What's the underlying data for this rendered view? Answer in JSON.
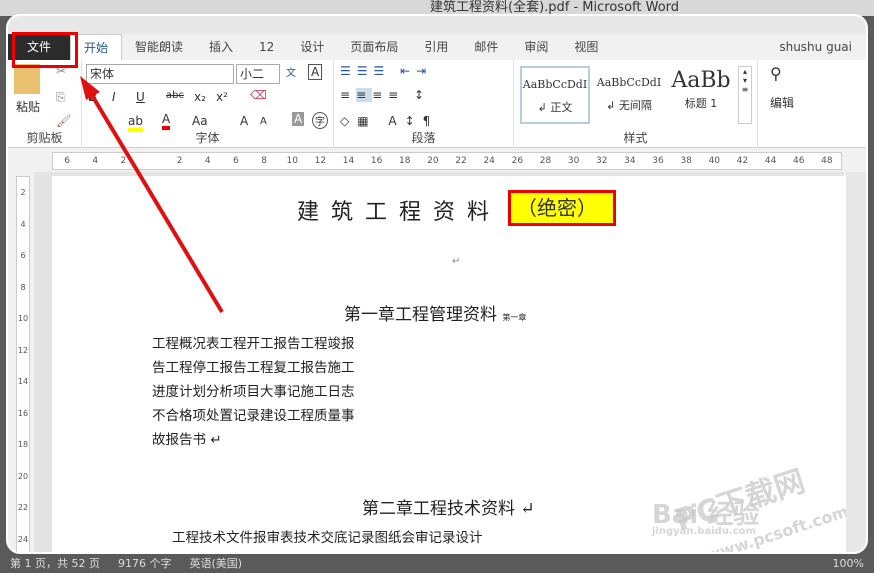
{
  "window": {
    "title": "建筑工程资料(全套).pdf - Microsoft Word",
    "user": "shushu guai"
  },
  "tabs": [
    {
      "label": "文件"
    },
    {
      "label": "开始"
    },
    {
      "label": "智能朗读"
    },
    {
      "label": "插入"
    },
    {
      "label": "12"
    },
    {
      "label": "设计"
    },
    {
      "label": "页面布局"
    },
    {
      "label": "引用"
    },
    {
      "label": "邮件"
    },
    {
      "label": "审阅"
    },
    {
      "label": "视图"
    }
  ],
  "ribbon": {
    "clipboard": {
      "label": "剪贴板",
      "paste": "粘贴"
    },
    "font": {
      "label": "字体",
      "name": "宋体",
      "size": "小二",
      "bold": "B",
      "italic": "I",
      "underline": "U",
      "strike": "abc",
      "sub": "x₂",
      "sup": "x²",
      "color": "A",
      "case": "Aa",
      "grow": "A",
      "shrink": "A",
      "wen": "文"
    },
    "paragraph": {
      "label": "段落"
    },
    "styles": {
      "label": "样式",
      "items": [
        {
          "preview": "AaBbCcDdI",
          "name": "↲ 正文"
        },
        {
          "preview": "AaBbCcDdI",
          "name": "↲ 无间隔"
        },
        {
          "preview": "AaBb",
          "name": "标题 1"
        }
      ]
    },
    "editing": {
      "label": "编辑"
    }
  },
  "ruler": {
    "h": [
      "6",
      "4",
      "2",
      "",
      "2",
      "4",
      "6",
      "8",
      "10",
      "12",
      "14",
      "16",
      "18",
      "20",
      "22",
      "24",
      "26",
      "28",
      "30",
      "32",
      "34",
      "36",
      "38",
      "40",
      "42",
      "44",
      "46",
      "48"
    ],
    "v": [
      "2",
      "4",
      "6",
      "8",
      "10",
      "12",
      "14",
      "16",
      "18",
      "20",
      "22",
      "24"
    ]
  },
  "document": {
    "title": "建筑工程资料",
    "title_highlight": "（绝密）",
    "ch1": "第一章工程管理资料",
    "ch1_tag": "第一章",
    "ch1_lines": [
      "工程概况表工程开工报告工程竣报",
      "告工程停工报告工程复工报告施工",
      "进度计划分析项目大事记施工日志",
      "不合格项处置记录建设工程质量事",
      "故报告书 ↵"
    ],
    "ch2": "第二章工程技术资料 ↵",
    "ch2_line": "工程技术文件报审表技术交底记录图纸会审记录设计"
  },
  "status": {
    "page": "第 1 页，共 52 页",
    "words": "9176 个字",
    "lang": "英语(美国)",
    "zoom": "100%"
  },
  "watermarks": [
    "Bai 经验",
    "jingyan.baidu.com",
    "PC下载网",
    "www.pcsoft.com.cn"
  ],
  "colors": {
    "accent": "#2b579a",
    "annotation": "#e00000",
    "highlight": "#ffff00"
  }
}
